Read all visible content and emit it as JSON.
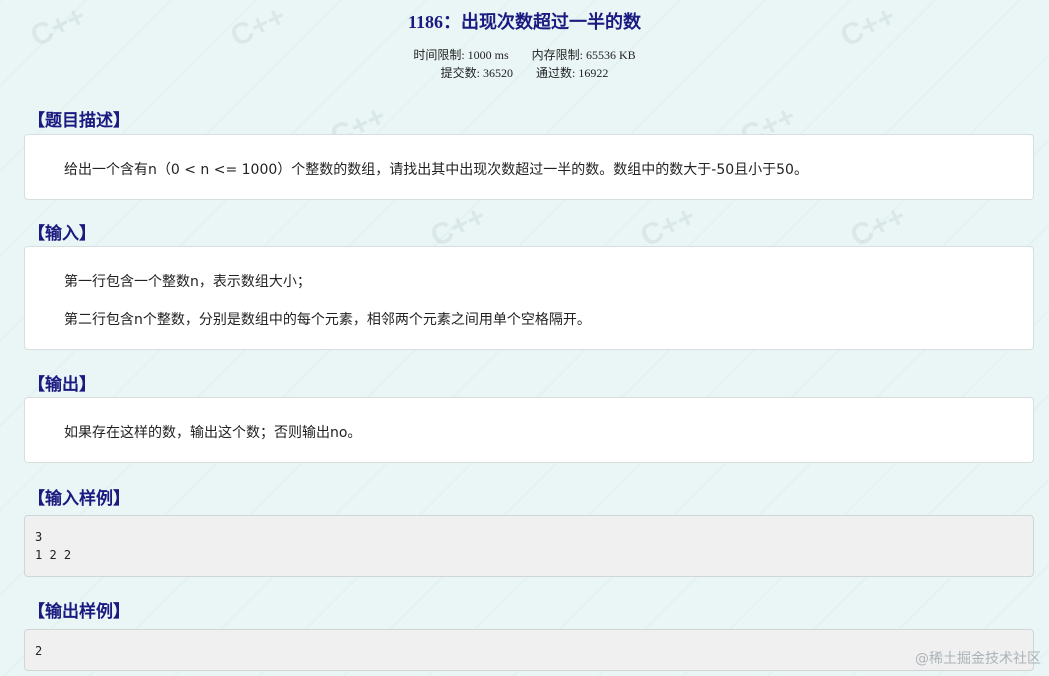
{
  "problem": {
    "title": "1186：出现次数超过一半的数",
    "time_limit": "时间限制: 1000 ms",
    "memory_limit": "内存限制: 65536 KB",
    "submissions": "提交数: 36520",
    "accepted": "通过数: 16922"
  },
  "sections": {
    "description_title": "【题目描述】",
    "description_text": "给出一个含有n（0 < n <= 1000）个整数的数组，请找出其中出现次数超过一半的数。数组中的数大于-50且小于50。",
    "input_title": "【输入】",
    "input_line1": "第一行包含一个整数n，表示数组大小；",
    "input_line2": "第二行包含n个整数，分别是数组中的每个元素，相邻两个元素之间用单个空格隔开。",
    "output_title": "【输出】",
    "output_text": "如果存在这样的数，输出这个数；否则输出no。",
    "sample_input_title": "【输入样例】",
    "sample_input": "3\n1 2 2",
    "sample_output_title": "【输出样例】",
    "sample_output": "2"
  },
  "footer": {
    "watermark": "@稀土掘金技术社区"
  }
}
